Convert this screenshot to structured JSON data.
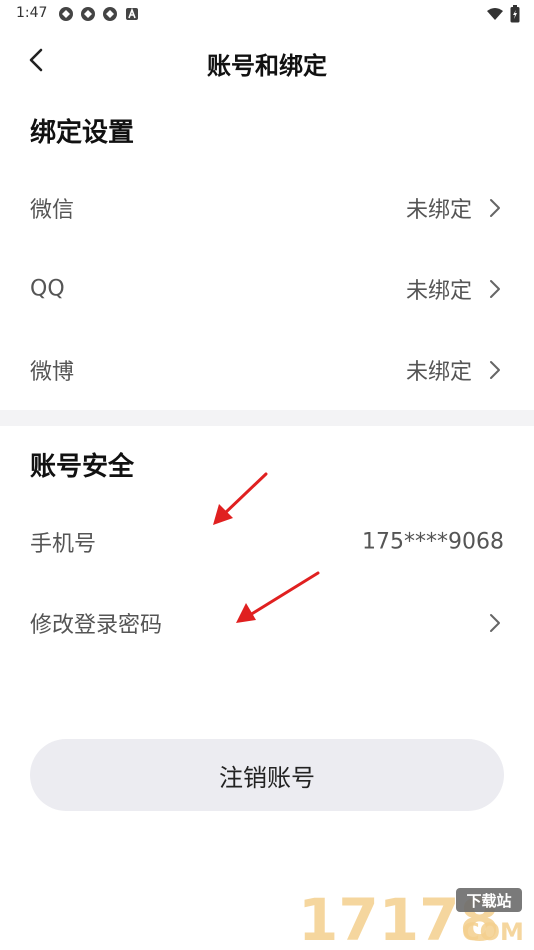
{
  "status_bar": {
    "time": "1:47",
    "left_icons": [
      "sync-icon",
      "sync-icon",
      "sync-icon",
      "a-badge-icon"
    ],
    "right_icons": [
      "wifi-icon",
      "battery-icon"
    ]
  },
  "header": {
    "title": "账号和绑定",
    "back_icon": "chevron-left-icon"
  },
  "binding_section": {
    "title": "绑定设置",
    "items": [
      {
        "label": "微信",
        "value": "未绑定"
      },
      {
        "label": "QQ",
        "value": "未绑定"
      },
      {
        "label": "微博",
        "value": "未绑定"
      }
    ]
  },
  "security_section": {
    "title": "账号安全",
    "phone": {
      "label": "手机号",
      "value": "175****9068"
    },
    "password": {
      "label": "修改登录密码"
    }
  },
  "deactivate_button": {
    "label": "注销账号"
  },
  "watermark": {
    "brand": "17178",
    "tag": "下载站",
    "suffix": "COM"
  },
  "colors": {
    "background": "#ffffff",
    "band": "#f3f3f5",
    "button": "#ececf1",
    "arrow": "#e02020",
    "label": "#555555",
    "title": "#111111"
  }
}
